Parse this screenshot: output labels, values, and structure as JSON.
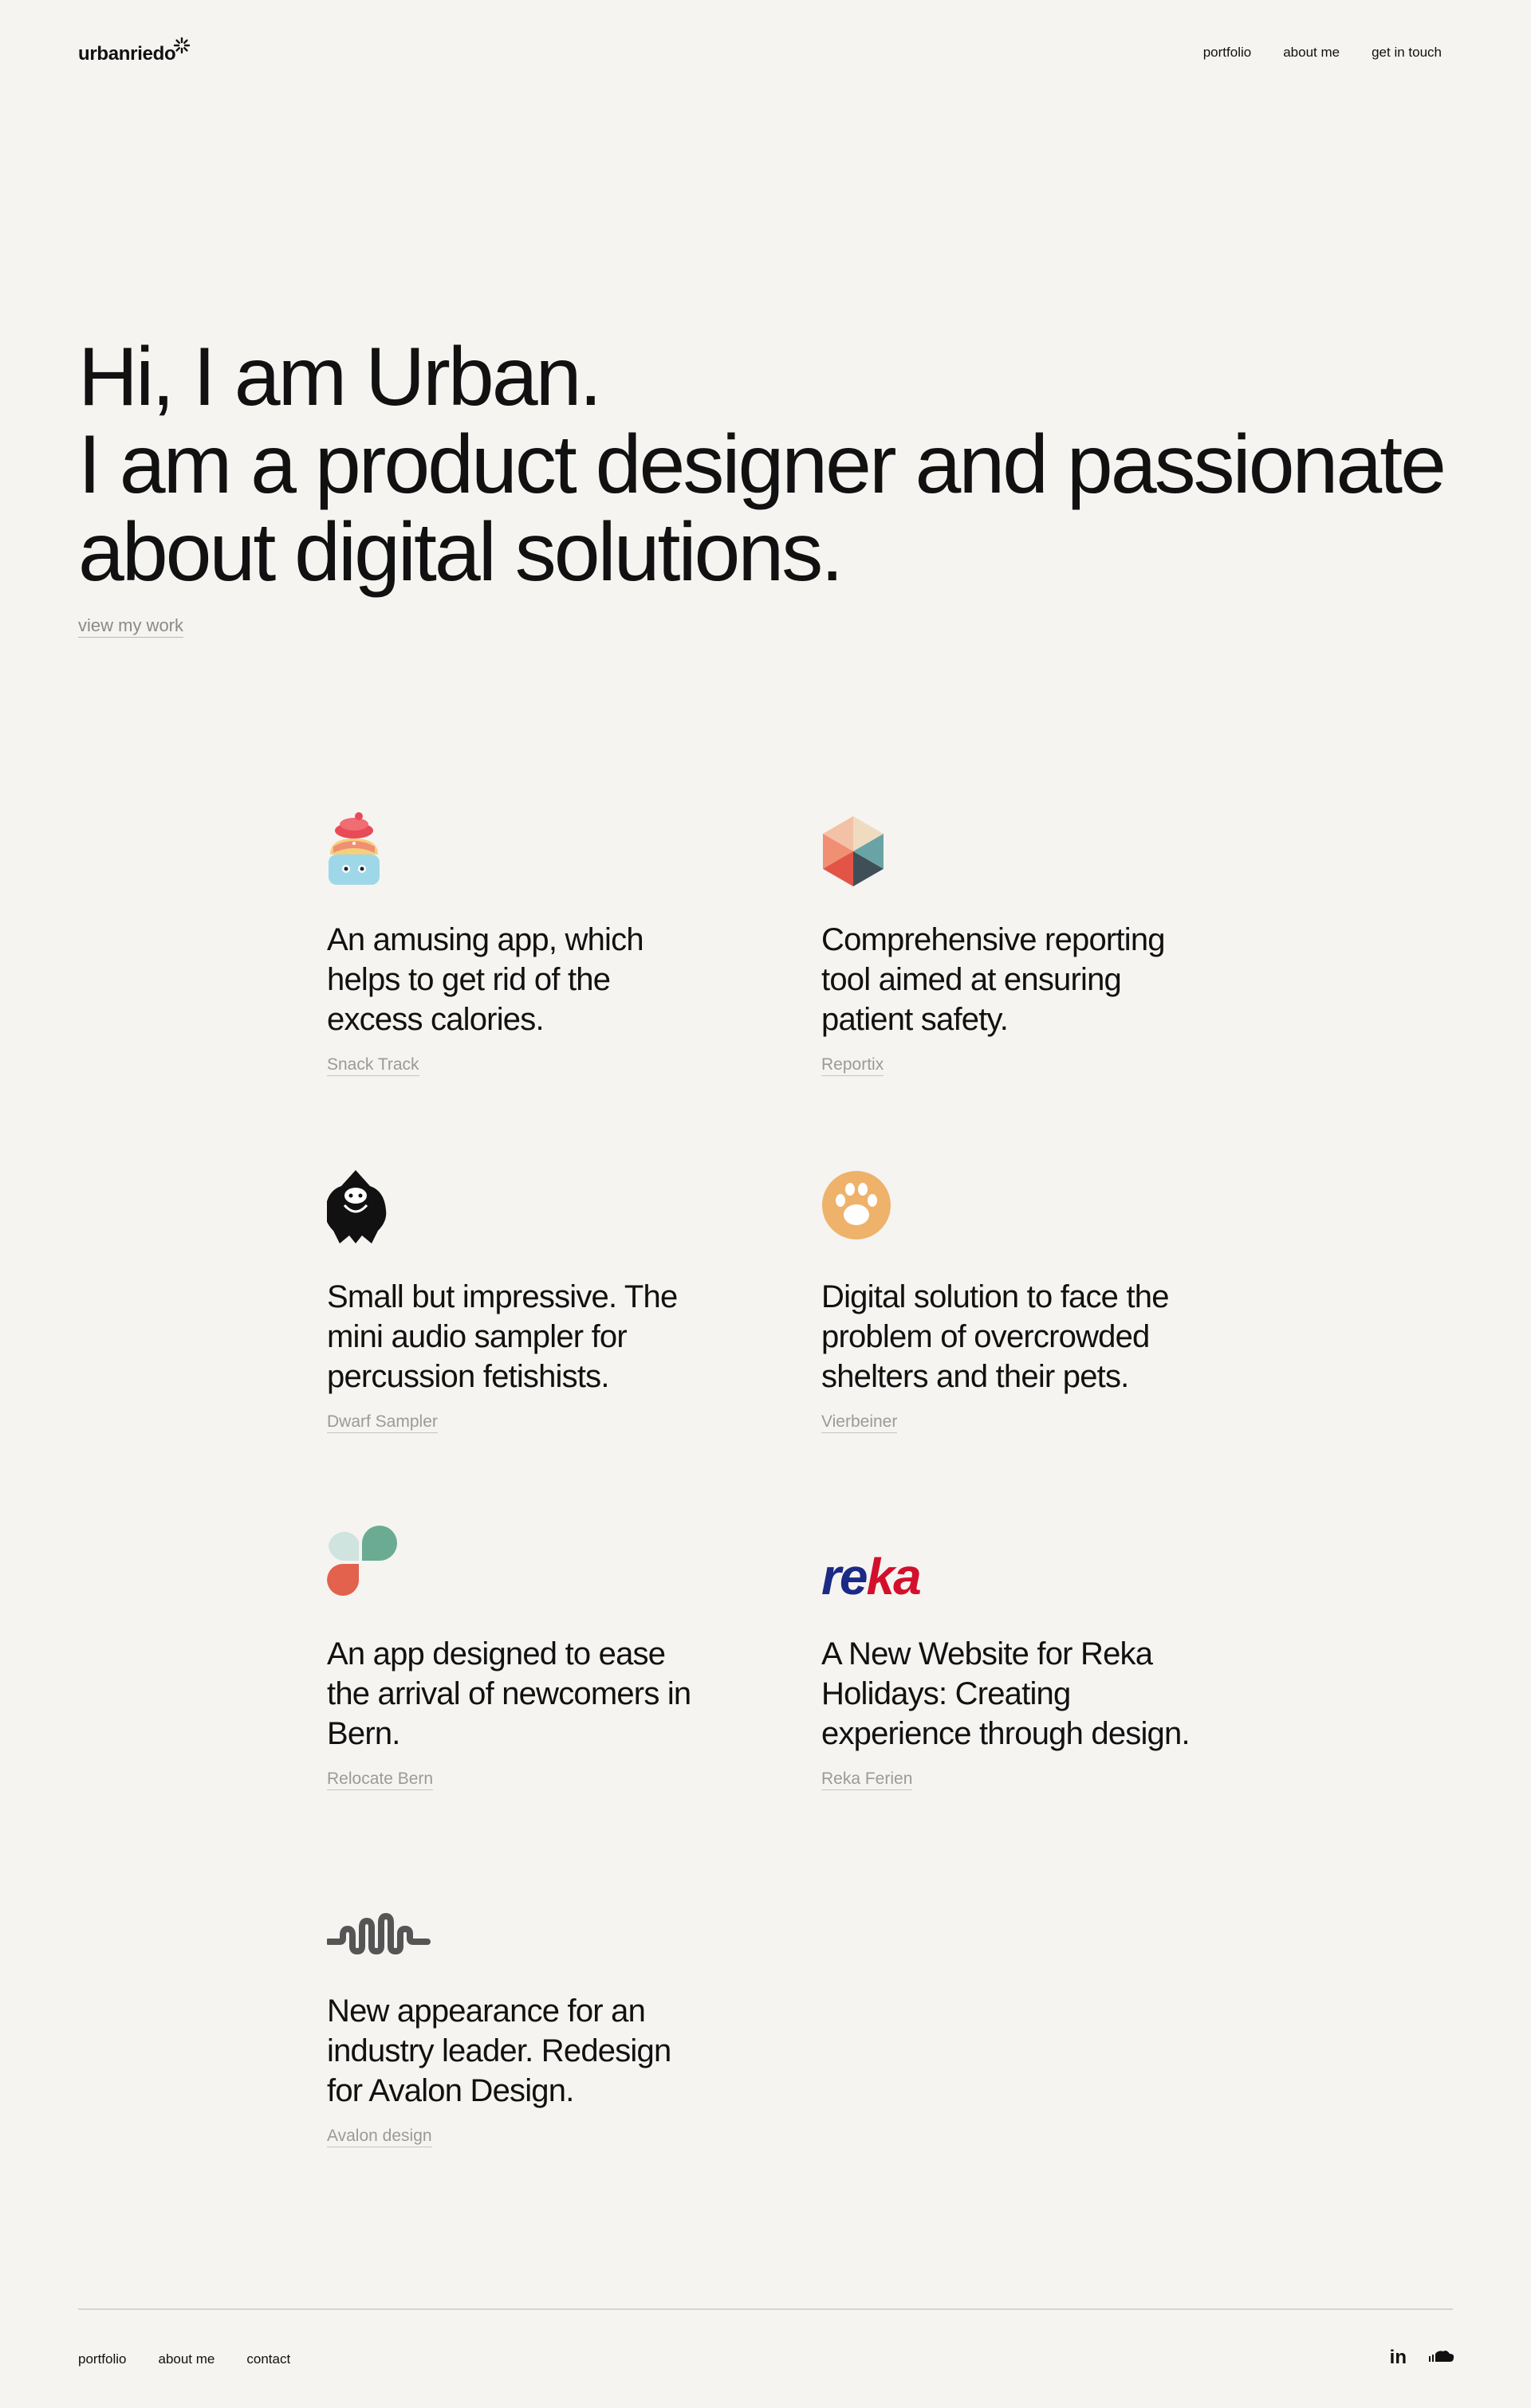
{
  "header": {
    "logo": "urbanriedo",
    "nav": [
      "portfolio",
      "about me",
      "get in touch"
    ]
  },
  "hero": {
    "line1": "Hi, I am Urban.",
    "line2": "I am a product designer and passionate",
    "line3": "about digital solutions.",
    "cta": "view my work"
  },
  "projects": [
    {
      "desc": "An amusing app, which helps to get rid of the excess calories.",
      "name": "Snack Track",
      "icon": "cupcake-icon"
    },
    {
      "desc": "Comprehensive reporting tool aimed at ensuring patient safety.",
      "name": "Reportix",
      "icon": "hexagon-cube-icon"
    },
    {
      "desc": "Small but impressive. The mini audio sampler for percussion fetishists.",
      "name": "Dwarf Sampler",
      "icon": "dwarf-icon"
    },
    {
      "desc": "Digital solution to face the problem of overcrowded shelters and their pets.",
      "name": "Vierbeiner",
      "icon": "paw-icon"
    },
    {
      "desc": "An app designed to ease the arrival of newcomers in Bern.",
      "name": "Relocate Bern",
      "icon": "petals-icon"
    },
    {
      "desc": "A New Website for Reka Holidays: Creating experience through design.",
      "name": "Reka Ferien",
      "icon": "reka-logo",
      "logo_text_1": "re",
      "logo_text_2": "ka"
    },
    {
      "desc": "New appearance for an industry leader. Redesign for Avalon Design.",
      "name": "Avalon design",
      "icon": "soundwave-icon"
    }
  ],
  "footer": {
    "nav": [
      "portfolio",
      "about me",
      "contact"
    ],
    "social": [
      "linkedin-icon",
      "soundcloud-icon"
    ],
    "linkedin_label": "in"
  },
  "colors": {
    "background": "#f5f4f1",
    "text": "#111111",
    "muted": "#9a9a9a",
    "reka_blue": "#1b2a86",
    "reka_red": "#d3102c"
  }
}
